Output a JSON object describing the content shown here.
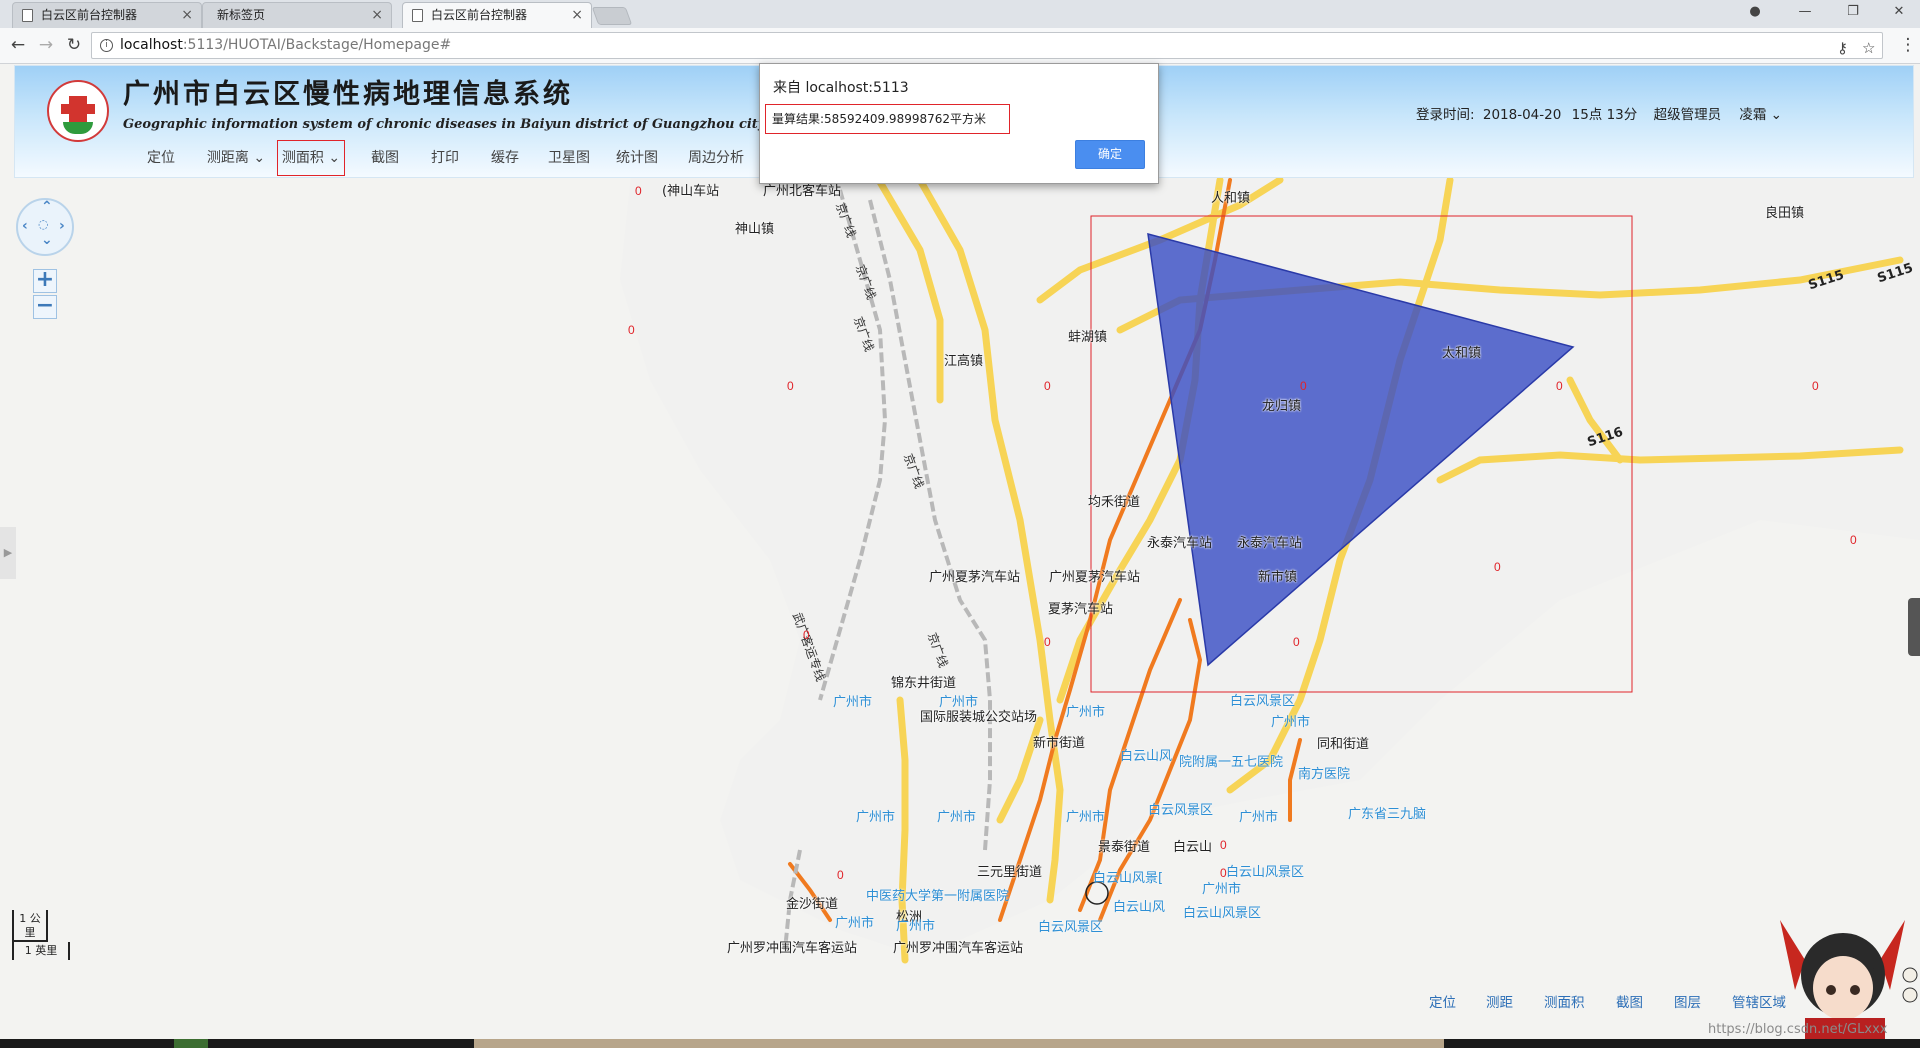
{
  "browser": {
    "tabs": [
      {
        "title": "白云区前台控制器",
        "active": false
      },
      {
        "title": "新标签页",
        "active": false
      },
      {
        "title": "白云区前台控制器",
        "active": true
      }
    ],
    "url_host": "localhost",
    "url_path": ":5113/HUOTAI/Backstage/Homepage#"
  },
  "header": {
    "title": "广州市白云区慢性病地理信息系统",
    "subtitle": "Geographic information system of chronic diseases in Baiyun district of Guangzhou city",
    "toolbar": [
      {
        "label": "定位",
        "dropdown": false,
        "selected": false
      },
      {
        "label": "测距离",
        "dropdown": true,
        "selected": false
      },
      {
        "label": "测面积",
        "dropdown": true,
        "selected": true
      },
      {
        "label": "截图",
        "dropdown": false,
        "selected": false
      },
      {
        "label": "打印",
        "dropdown": false,
        "selected": false
      },
      {
        "label": "缓存",
        "dropdown": false,
        "selected": false
      },
      {
        "label": "卫星图",
        "dropdown": false,
        "selected": false
      },
      {
        "label": "统计图",
        "dropdown": false,
        "selected": false
      },
      {
        "label": "周边分析",
        "dropdown": false,
        "selected": false
      }
    ],
    "login_label": "登录时间:",
    "login_date": "2018-04-20",
    "login_time": "15点  13分",
    "user_role": "超级管理员",
    "user_name": "凌霜"
  },
  "dialog": {
    "title": "来自 localhost:5113",
    "message": "量算结果:58592409.98998762平方米",
    "ok_label": "确定"
  },
  "map": {
    "places": [
      {
        "text": "神山镇",
        "kind": "black"
      },
      {
        "text": "人和镇",
        "kind": "black"
      },
      {
        "text": "良田镇",
        "kind": "black"
      },
      {
        "text": "江高镇",
        "kind": "black"
      },
      {
        "text": "蚌湖镇",
        "kind": "black"
      },
      {
        "text": "太和镇",
        "kind": "black"
      },
      {
        "text": "龙归镇",
        "kind": "black"
      },
      {
        "text": "均禾街道",
        "kind": "black"
      },
      {
        "text": "永泰汽车站",
        "kind": "black"
      },
      {
        "text": "永泰汽车站",
        "kind": "black"
      },
      {
        "text": "新市镇",
        "kind": "black"
      },
      {
        "text": "广州夏茅汽车站",
        "kind": "black"
      },
      {
        "text": "广州夏茅汽车站",
        "kind": "black"
      },
      {
        "text": "夏茅汽车站",
        "kind": "black"
      },
      {
        "text": "锦东井街道",
        "kind": "black"
      },
      {
        "text": "国际服装城公交站场",
        "kind": "black"
      },
      {
        "text": "新市街道",
        "kind": "black"
      },
      {
        "text": "同和街道",
        "kind": "black"
      },
      {
        "text": "景泰街道",
        "kind": "black"
      },
      {
        "text": "白云山",
        "kind": "black"
      },
      {
        "text": "三元里街道",
        "kind": "black"
      },
      {
        "text": "金沙街道",
        "kind": "black"
      },
      {
        "text": "广州罗冲围汽车客运站",
        "kind": "black"
      },
      {
        "text": "广州罗冲围汽车客运站",
        "kind": "black"
      },
      {
        "text": "松洲",
        "kind": "black"
      },
      {
        "text": "广州市",
        "kind": "blue"
      },
      {
        "text": "广州市",
        "kind": "blue"
      },
      {
        "text": "广州市",
        "kind": "blue"
      },
      {
        "text": "广州市",
        "kind": "blue"
      },
      {
        "text": "广州市",
        "kind": "blue"
      },
      {
        "text": "广州市",
        "kind": "blue"
      },
      {
        "text": "广州市",
        "kind": "blue"
      },
      {
        "text": "广州市",
        "kind": "blue"
      },
      {
        "text": "广州市",
        "kind": "blue"
      },
      {
        "text": "广州市",
        "kind": "blue"
      },
      {
        "text": "广州市",
        "kind": "blue"
      },
      {
        "text": "白云风景区",
        "kind": "blue"
      },
      {
        "text": "白云山风",
        "kind": "blue"
      },
      {
        "text": "院附属一五七医院",
        "kind": "blue"
      },
      {
        "text": "南方医院",
        "kind": "blue"
      },
      {
        "text": "白云风景区",
        "kind": "blue"
      },
      {
        "text": "广东省三九脑",
        "kind": "blue"
      },
      {
        "text": "白云山风景区",
        "kind": "blue"
      },
      {
        "text": "白云山风景[",
        "kind": "blue"
      },
      {
        "text": "中医药大学第一附属医院",
        "kind": "blue"
      },
      {
        "text": "白云山风",
        "kind": "blue"
      },
      {
        "text": "白云山风景区",
        "kind": "blue"
      },
      {
        "text": "白云风景区",
        "kind": "blue"
      },
      {
        "text": "京广线",
        "kind": "rail"
      },
      {
        "text": "京广线",
        "kind": "rail"
      },
      {
        "text": "京广线",
        "kind": "rail"
      },
      {
        "text": "京广线",
        "kind": "rail"
      },
      {
        "text": "京广线",
        "kind": "rail"
      },
      {
        "text": "武广客运专线",
        "kind": "rail"
      },
      {
        "text": "S115",
        "kind": "road"
      },
      {
        "text": "S115",
        "kind": "road"
      },
      {
        "text": "S116",
        "kind": "road"
      },
      {
        "text": "(神山车站",
        "kind": "black"
      },
      {
        "text": "广州北客车站",
        "kind": "black"
      }
    ],
    "zero_marker": "0",
    "scale_km": "1 公里",
    "scale_mi": "1 英里",
    "pan_icon": "pan-arrows-icon",
    "zoom_in": "+",
    "zoom_out": "−"
  },
  "bottom_tools": [
    "定位",
    "测距",
    "测面积",
    "截图",
    "图层",
    "管辖区域"
  ],
  "watermark": "https://blog.csdn.net/GLxxx",
  "colors": {
    "polygon_fill": "#3b4fc4",
    "selection_red": "#e0242a",
    "road_yellow": "#f7d456",
    "road_orange": "#f07a1f",
    "place_blue": "#2d8fd5",
    "header_blue": "#9fd0f6"
  }
}
